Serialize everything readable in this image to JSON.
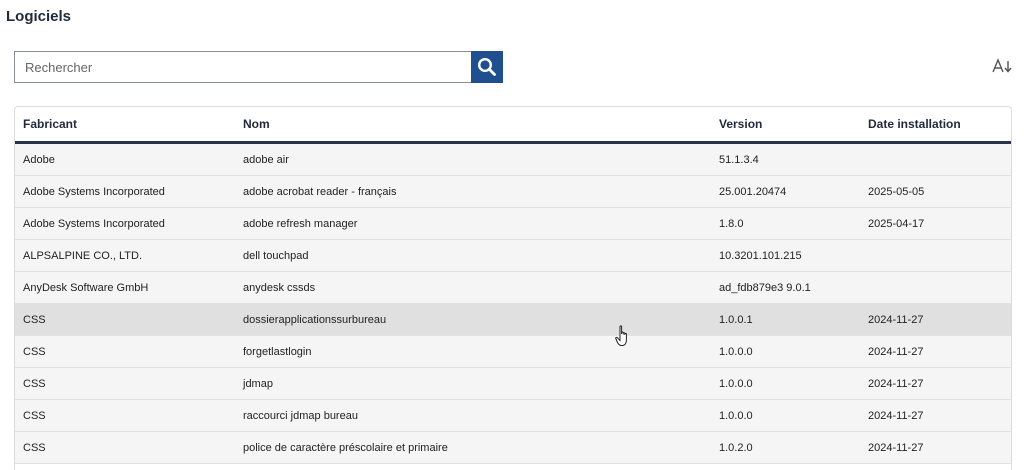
{
  "page": {
    "title": "Logiciels"
  },
  "search": {
    "placeholder": "Rechercher",
    "value": ""
  },
  "icons": {
    "search": "search-icon",
    "sort": "sort-alpha-icon",
    "cursor": "hand-pointer-icon"
  },
  "colors": {
    "search_button": "#1f4f8f",
    "header_border": "#26344d",
    "row_bg": "#f5f5f5",
    "row_hover_bg": "#e0e0e0"
  },
  "table": {
    "columns": [
      "Fabricant",
      "Nom",
      "Version",
      "Date installation"
    ],
    "rows": [
      {
        "fabricant": "Adobe",
        "nom": "adobe air",
        "version": "51.1.3.4",
        "date": ""
      },
      {
        "fabricant": "Adobe Systems Incorporated",
        "nom": "adobe acrobat reader - français",
        "version": "25.001.20474",
        "date": "2025-05-05"
      },
      {
        "fabricant": "Adobe Systems Incorporated",
        "nom": "adobe refresh manager",
        "version": "1.8.0",
        "date": "2025-04-17"
      },
      {
        "fabricant": "ALPSALPINE CO., LTD.",
        "nom": "dell touchpad",
        "version": "10.3201.101.215",
        "date": ""
      },
      {
        "fabricant": "AnyDesk Software GmbH",
        "nom": "anydesk cssds",
        "version": "ad_fdb879e3 9.0.1",
        "date": ""
      },
      {
        "fabricant": "CSS",
        "nom": "dossierapplicationssurbureau",
        "version": "1.0.0.1",
        "date": "2024-11-27"
      },
      {
        "fabricant": "CSS",
        "nom": "forgetlastlogin",
        "version": "1.0.0.0",
        "date": "2024-11-27"
      },
      {
        "fabricant": "CSS",
        "nom": "jdmap",
        "version": "1.0.0.0",
        "date": "2024-11-27"
      },
      {
        "fabricant": "CSS",
        "nom": "raccourci jdmap bureau",
        "version": "1.0.0.0",
        "date": "2024-11-27"
      },
      {
        "fabricant": "CSS",
        "nom": "police de caractère préscolaire et primaire",
        "version": "1.0.2.0",
        "date": "2024-11-27"
      }
    ]
  }
}
